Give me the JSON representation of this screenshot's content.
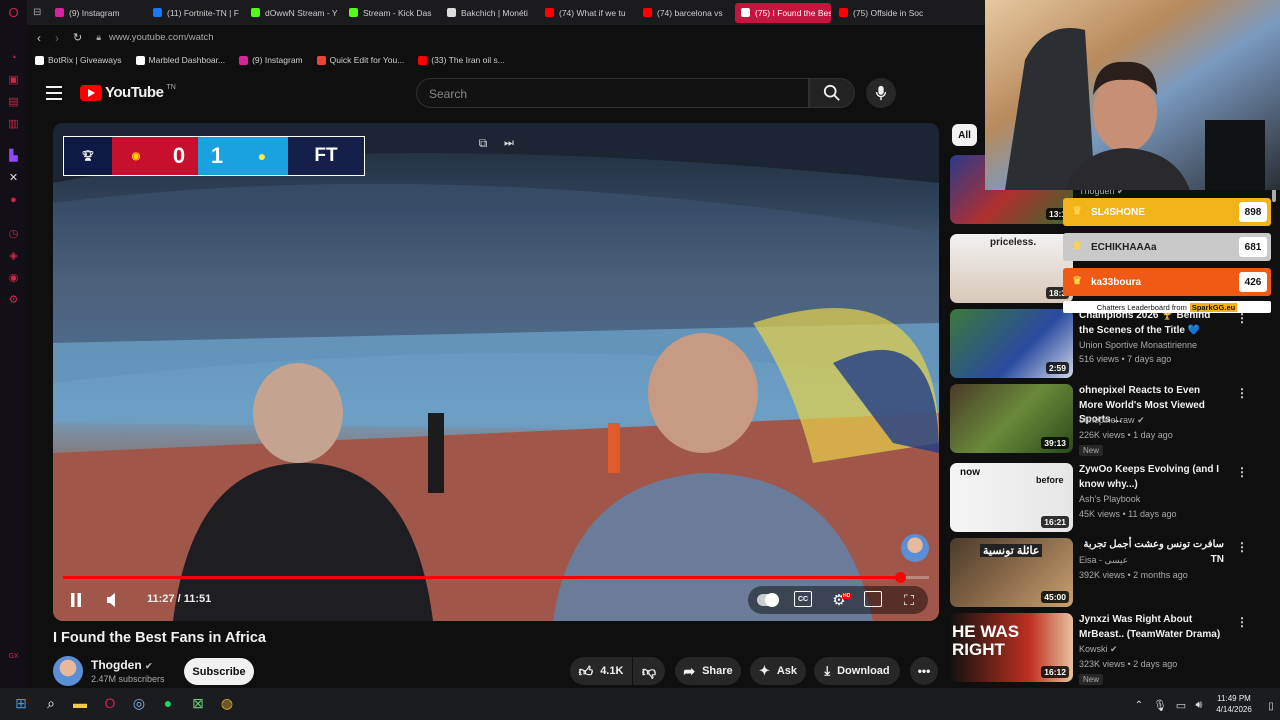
{
  "browser": {
    "tabs": [
      {
        "label": "(9) Instagram",
        "color": "#d6249f"
      },
      {
        "label": "(11) Fortnite-TN | F",
        "color": "#1877f2"
      },
      {
        "label": "dOwwN Stream - Y",
        "color": "#53fc18"
      },
      {
        "label": "Stream - Kick Das",
        "color": "#53fc18"
      },
      {
        "label": "Bakchich | Monéti",
        "color": "#dddddd"
      },
      {
        "label": "(74) What if we tu",
        "color": "#ff0000"
      },
      {
        "label": "(74) barcelona vs",
        "color": "#ff0000"
      },
      {
        "label": "(75) I Found the Best F",
        "color": "#ffffff"
      },
      {
        "label": "(75) Offside in Soc",
        "color": "#ff0000"
      }
    ],
    "url": "www.youtube.com/watch",
    "bookmarks": [
      {
        "label": "BotRix | Giveaways",
        "color": "#ffffff"
      },
      {
        "label": "Marbled Dashboar...",
        "color": "#ffffff"
      },
      {
        "label": "(9) Instagram",
        "color": "#d6249f"
      },
      {
        "label": "Quick Edit for You...",
        "color": "#ea4335"
      },
      {
        "label": "(33) The Iran oil s...",
        "color": "#ff0000"
      }
    ]
  },
  "youtube": {
    "logo_text": "YouTube",
    "region": "TN",
    "search_placeholder": "Search"
  },
  "player": {
    "scoreboard": {
      "home_score": "0",
      "away_score": "1",
      "status": "FT"
    },
    "time": "11:27 / 11:51",
    "progress": 0.967,
    "hd_badge": "HD"
  },
  "video_info": {
    "title": "I Found the Best Fans in Africa",
    "channel": "Thogden",
    "subscribers": "2.47M subscribers",
    "subscribe_label": "Subscribe",
    "likes": "4.1K",
    "share_label": "Share",
    "ask_label": "Ask",
    "download_label": "Download"
  },
  "sidebar": {
    "chip_all": "All",
    "recos": [
      {
        "title": "",
        "channel": "Thogden",
        "meta": "",
        "duration": "13:1",
        "new": ""
      },
      {
        "title": "",
        "channel": "",
        "meta": "",
        "duration": "18:3",
        "new": "",
        "thumb_text": "priceless."
      },
      {
        "title": "Champions 2026 🏆 Behind the Scenes of the Title 💙",
        "channel": "Union Sportive Monastirienne",
        "meta": "516 views • 7 days ago",
        "duration": "2:59",
        "new": ""
      },
      {
        "title": "ohnepixel Reacts to Even More World's Most Viewed Sports ...",
        "channel": "ohnepixel raw",
        "meta": "226K views • 1 day ago",
        "duration": "39:13",
        "new": "New"
      },
      {
        "title": "ZywOo Keeps Evolving (and I know why...)",
        "channel": "Ash's Playbook",
        "meta": "45K views • 11 days ago",
        "duration": "16:21",
        "new": "",
        "thumb_text_a": "now",
        "thumb_text_b": "before"
      },
      {
        "title": "سافرت تونس وعشت أجمل تجربة TN",
        "channel": "Eisa - عيسى",
        "meta": "392K views • 2 months ago",
        "duration": "45:00",
        "new": "",
        "thumb_text": "عائلة تونسية"
      },
      {
        "title": "Jynxzi Was Right About MrBeast.. (TeamWater Drama)",
        "channel": "Kowski",
        "meta": "323K views • 2 days ago",
        "duration": "16:12",
        "new": "New",
        "thumb_text": "HE WAS RIGHT"
      }
    ]
  },
  "leaderboard": {
    "entries": [
      {
        "name": "SL4SHONE",
        "score": "898",
        "color": "#f2b21a"
      },
      {
        "name": "ECHIKHAAAa",
        "score": "681",
        "color": "#c9c9c9"
      },
      {
        "name": "ka33boura",
        "score": "426",
        "color": "#f05a14"
      }
    ],
    "footer": "Chatters Leaderboard from",
    "footer_brand": "SparkGG.eu"
  },
  "taskbar": {
    "time": "11:49 PM",
    "date": "4/14/2026"
  }
}
